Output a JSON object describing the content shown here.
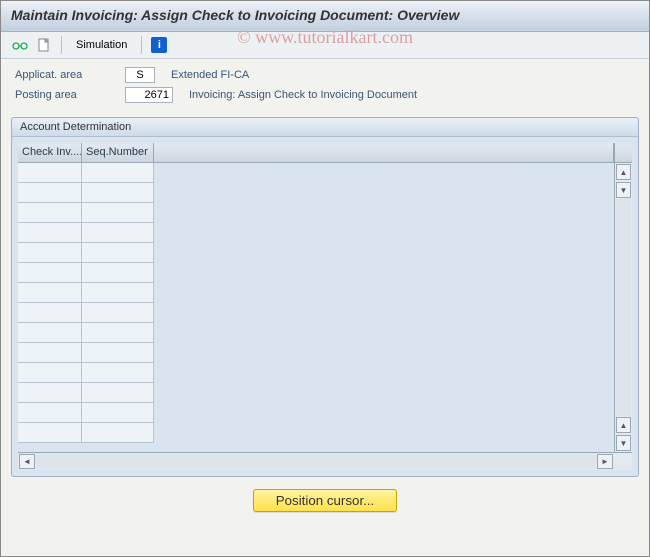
{
  "title": "Maintain Invoicing: Assign Check to Invoicing Document: Overview",
  "watermark": "© www.tutorialkart.com",
  "toolbar": {
    "simulation_label": "Simulation"
  },
  "form": {
    "applicat_label": "Applicat. area",
    "applicat_value": "S",
    "applicat_desc": "Extended FI-CA",
    "posting_label": "Posting area",
    "posting_value": "2671",
    "posting_desc": "Invoicing: Assign Check to Invoicing Document"
  },
  "panel": {
    "title": "Account Determination",
    "col1": "Check Inv....",
    "col2": "Seq.Number",
    "row_count": 14
  },
  "buttons": {
    "position": "Position cursor..."
  }
}
